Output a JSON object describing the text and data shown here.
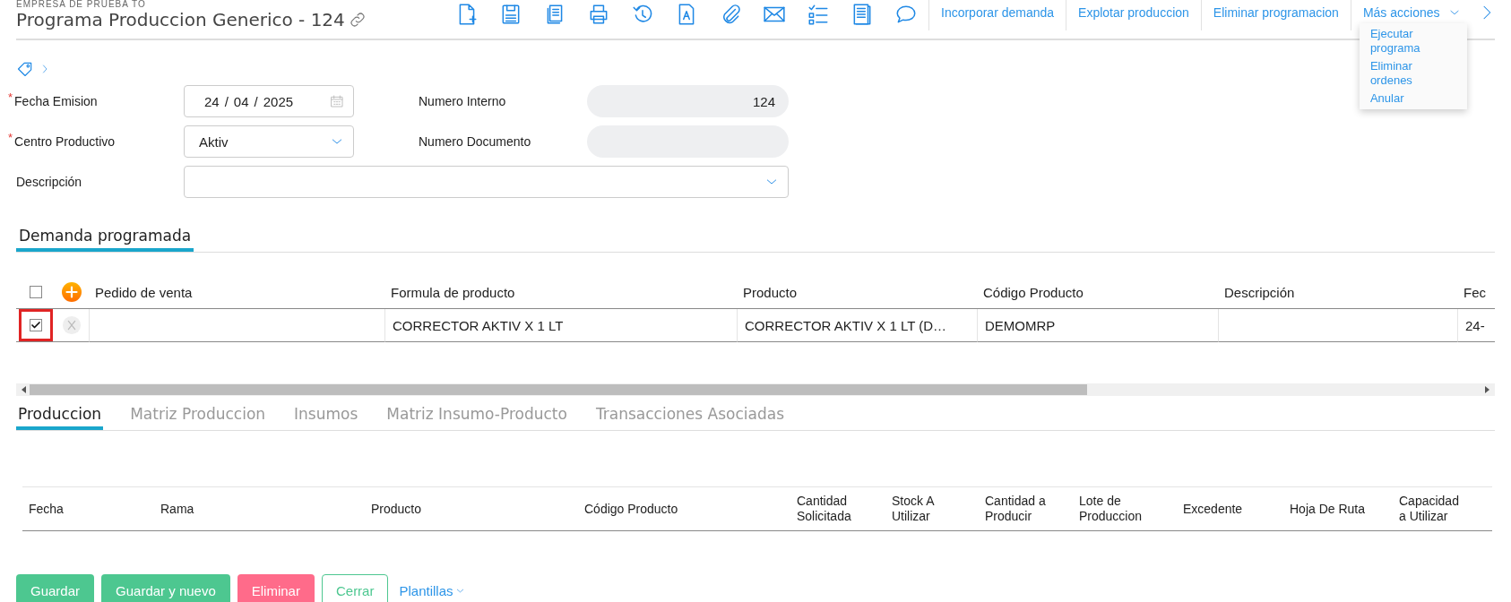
{
  "header": {
    "company": "EMPRESA DE PRUEBA TO",
    "title": "Programa Produccion Generico - 124",
    "toolbar_icons": [
      {
        "kind": "file-plus"
      },
      {
        "kind": "save"
      },
      {
        "kind": "copy"
      },
      {
        "kind": "print"
      },
      {
        "kind": "history"
      },
      {
        "kind": "text-doc"
      },
      {
        "kind": "attach"
      },
      {
        "kind": "mail"
      },
      {
        "kind": "checklist"
      },
      {
        "kind": "notebook"
      },
      {
        "kind": "comment"
      }
    ],
    "actions": [
      {
        "label": "Incorporar demanda"
      },
      {
        "label": "Explotar produccion"
      },
      {
        "label": "Eliminar programacion"
      }
    ],
    "more": {
      "label": "Más acciones",
      "expanded": true,
      "items": [
        {
          "label": "Ejecutar programa"
        },
        {
          "label": "Eliminar ordenes"
        },
        {
          "label": "Anular"
        }
      ]
    }
  },
  "form": {
    "fields": [
      {
        "label": "Fecha Emision",
        "required_mark": "*",
        "kind": "date",
        "day": "24",
        "month": "04",
        "year": "2025",
        "separator": "/",
        "label2": "Numero Interno",
        "value2": "124"
      },
      {
        "label": "Centro Productivo",
        "required_mark": "*",
        "kind": "select",
        "value": "Aktiv",
        "label2": "Numero Documento"
      },
      {
        "label": "Descripción",
        "kind": "wide-select"
      }
    ]
  },
  "demand": {
    "title": "Demanda programada",
    "header_checked": false,
    "columns": [
      "Pedido de venta",
      "Formula de producto",
      "Producto",
      "Código Producto",
      "Descripción",
      "Fec"
    ],
    "rows": [
      {
        "checked": true,
        "highlighted": true,
        "cells": [
          null,
          "CORRECTOR AKTIV X 1 LT",
          "CORRECTOR AKTIV X 1 LT (D…",
          "DEMOMRP",
          null,
          "24-"
        ]
      }
    ]
  },
  "tabs": [
    {
      "label": "Produccion",
      "selected": true
    },
    {
      "label": "Matriz Produccion",
      "selected": false
    },
    {
      "label": "Insumos",
      "selected": false
    },
    {
      "label": "Matriz Insumo-Producto",
      "selected": false
    },
    {
      "label": "Transacciones Asociadas",
      "selected": false
    }
  ],
  "production_table": {
    "columns": [
      "Fecha",
      "Rama",
      "Producto",
      "Código Producto",
      "Cantidad Solicitada",
      "Stock A Utilizar",
      "Cantidad a Producir",
      "Lote de Produccion",
      "Excedente",
      "Hoja De Ruta",
      "Capacidad a Utilizar"
    ]
  },
  "buttons": [
    {
      "label": "Guardar",
      "kind": "green"
    },
    {
      "label": "Guardar y nuevo",
      "kind": "green"
    },
    {
      "label": "Eliminar",
      "kind": "red"
    },
    {
      "label": "Cerrar",
      "kind": "outline"
    },
    {
      "label": "Plantillas",
      "kind": "link"
    }
  ]
}
